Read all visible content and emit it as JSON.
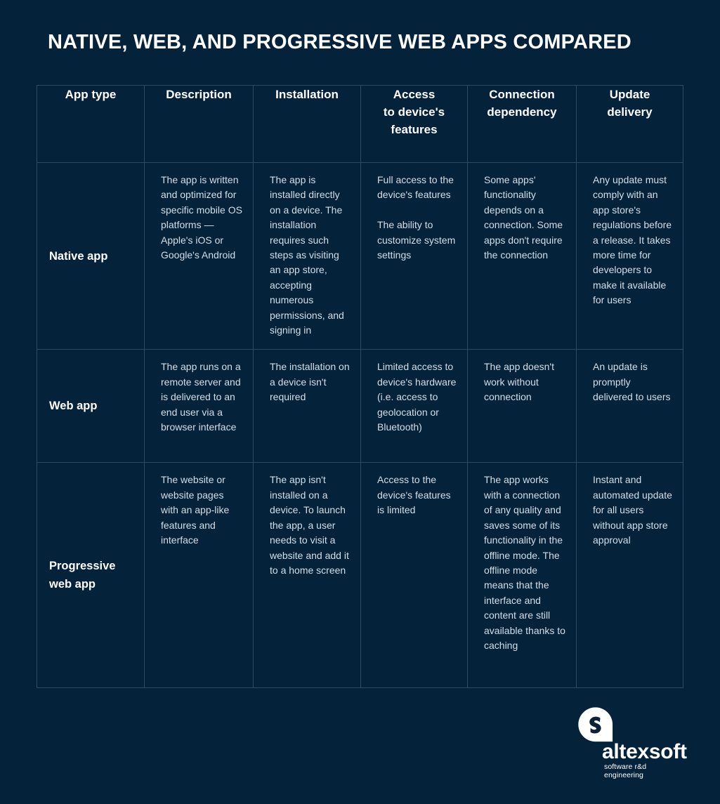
{
  "title": "NATIVE, WEB, AND PROGRESSIVE WEB APPS COMPARED",
  "colors": {
    "background": "#04223a",
    "border": "#2c4b64",
    "heading_text": "#ffffff",
    "body_text": "#d4dfe8"
  },
  "table": {
    "headers": [
      "App type",
      "Description",
      "Installation",
      "Access\nto device's\nfeatures",
      "Connection\ndependency",
      "Update\ndelivery"
    ],
    "rows": [
      {
        "app_type": "Native app",
        "description": "The app is written and optimized for specific mobile OS platforms — Apple's iOS or Google's Android",
        "installation": "The app is installed directly on a device. The installation requires such steps as visiting an app store, accepting numerous permissions, and signing in",
        "access_to_device_features": "Full access to the device's features\n\nThe ability to customize system settings",
        "connection_dependency": "Some apps' functionality depends on a connection. Some apps don't require the connection",
        "update_delivery": "Any update must comply with an app store's regulations before a release. It takes more time for developers to make it available for users"
      },
      {
        "app_type": "Web app",
        "description": "The app runs on a remote server and is delivered to an end user via a browser interface",
        "installation": "The installation on a device isn't required",
        "access_to_device_features": "Limited access to device's hardware (i.e. access to geolocation or Bluetooth)",
        "connection_dependency": "The app doesn't work without connection",
        "update_delivery": "An update is promptly delivered to users"
      },
      {
        "app_type": "Progressive\nweb app",
        "description": "The website or website pages with an app-like features and interface",
        "installation": "The app isn't installed on a device. To launch the app, a user needs to visit a website and add it to a home screen",
        "access_to_device_features": "Access to the device's features is limited",
        "connection_dependency": "The app works with a connection of any quality and saves some of its functionality in the offline mode. The offline mode means that the interface and content are still available thanks to caching",
        "update_delivery": "Instant and automated update for all users without app store approval"
      }
    ]
  },
  "logo": {
    "name": "altexsoft",
    "tagline": "software r&d engineering"
  }
}
